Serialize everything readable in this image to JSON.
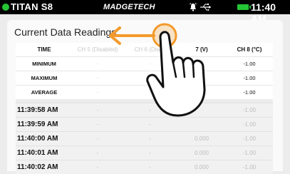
{
  "status_bar": {
    "device_name": "TITAN S8",
    "brand": "MadgeTech",
    "icons": [
      "alarm-bell-icon",
      "usb-icon",
      "battery-icon"
    ],
    "clock": "11:40 AM",
    "colors": {
      "status_dot": "#25c435",
      "battery": "#25c435"
    }
  },
  "page": {
    "title": "Current Data Readings"
  },
  "table": {
    "headers": [
      "TIME",
      "CH 5 (Disabled)",
      "CH 6 (Disab",
      "7 (V)",
      "CH 8 (°C)"
    ],
    "stats": [
      {
        "label": "MINIMUM",
        "cells": [
          "-",
          "-",
          "",
          "-1.00"
        ]
      },
      {
        "label": "MAXIMUM",
        "cells": [
          "-",
          "-",
          "",
          "-1.00"
        ]
      },
      {
        "label": "AVERAGE",
        "cells": [
          "-",
          "-",
          "",
          "-1.00"
        ]
      }
    ],
    "readings": [
      {
        "time": "11:39:58 AM",
        "cells": [
          "-",
          "-",
          "",
          "-1.00"
        ]
      },
      {
        "time": "11:39:59 AM",
        "cells": [
          "-",
          "-",
          "",
          "-1.00"
        ]
      },
      {
        "time": "11:40:00 AM",
        "cells": [
          "-",
          "-",
          "0.000",
          "-1.00"
        ]
      },
      {
        "time": "11:40:01 AM",
        "cells": [
          "-",
          "-",
          "0.000",
          "-1.00"
        ]
      },
      {
        "time": "11:40:02 AM",
        "cells": [
          "-",
          "-",
          "0.000",
          "-1.00"
        ]
      }
    ]
  },
  "overlay": {
    "gesture": "swipe-left",
    "icons": [
      "swipe-left-arrow-icon",
      "pointing-hand-icon"
    ],
    "colors": {
      "accent": "#f39a2b"
    }
  }
}
